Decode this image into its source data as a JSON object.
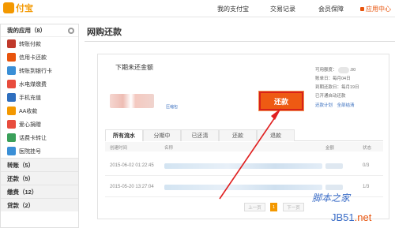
{
  "header": {
    "logo_text": "付宝",
    "nav": [
      "我的支付宝",
      "交易记录",
      "会员保障"
    ],
    "app_center": "应用中心",
    "accent": "#f39800"
  },
  "sidebar": {
    "title": "我的应用（8）",
    "apps": [
      {
        "label": "转账付款",
        "icon": "wallet-icon",
        "color": "#c0392b"
      },
      {
        "label": "信用卡还款",
        "icon": "credit-card-icon",
        "color": "#e8540d"
      },
      {
        "label": "转账到银行卡",
        "icon": "bank-card-icon",
        "color": "#3a8fd6"
      },
      {
        "label": "水电煤缴费",
        "icon": "utility-icon",
        "color": "#e84c3d"
      },
      {
        "label": "手机充值",
        "icon": "phone-icon",
        "color": "#2f6fbf"
      },
      {
        "label": "AA收款",
        "icon": "aa-icon",
        "color": "#f39800"
      },
      {
        "label": "爱心捐赠",
        "icon": "heart-icon",
        "color": "#e84c3d"
      },
      {
        "label": "话费卡转让",
        "icon": "card-transfer-icon",
        "color": "#3aa05a"
      },
      {
        "label": "医院挂号",
        "icon": "hospital-icon",
        "color": "#3a8fd6"
      }
    ],
    "sections": [
      "转账（5）",
      "还款（5）",
      "缴费（12）",
      "贷款（2）"
    ]
  },
  "main": {
    "title": "网购还款",
    "due_label": "下期未还金额",
    "pay_button": "还款",
    "small_link": "压缩包",
    "info": {
      "available_prefix": "可用额度：",
      "available_suffix": ".00",
      "bill_date": "账单日：每月04日",
      "due_date": "到期还款日：每月19日",
      "auto_pay": "已开通自动还款",
      "links": [
        "还款计划",
        "全部结清"
      ]
    },
    "tabs": [
      "所有流水",
      "分期中",
      "已还清",
      "还款",
      "退款"
    ],
    "table": {
      "headers": [
        "创建时间",
        "名称",
        "金额",
        "状态"
      ],
      "rows": [
        {
          "time": "2015-06-02 01:22:45",
          "status": "0/3"
        },
        {
          "time": "2015-05-20 13:27:04",
          "status": "1/3"
        }
      ]
    },
    "pager": {
      "prev": "上一页",
      "current": "1",
      "next": "下一页"
    }
  },
  "watermark": {
    "text": "脚本之家",
    "url": "JB51",
    "url_tld": ".net"
  }
}
